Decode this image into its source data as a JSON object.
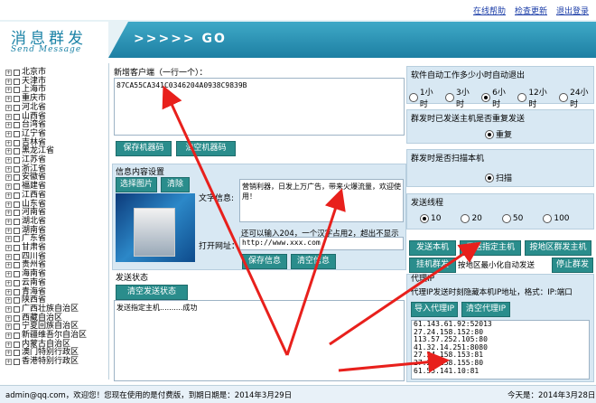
{
  "header": {
    "links": [
      "在线帮助",
      "检查更新",
      "退出登录"
    ],
    "logo_title": "消息群发",
    "logo_subtitle": "Send Message",
    "go_prefix": ">>>>>",
    "go_label": "GO"
  },
  "provinces": [
    "北京市",
    "天津市",
    "上海市",
    "重庆市",
    "河北省",
    "山西省",
    "台湾省",
    "辽宁省",
    "吉林省",
    "黑龙江省",
    "江苏省",
    "浙江省",
    "安徽省",
    "福建省",
    "江西省",
    "山东省",
    "河南省",
    "湖北省",
    "湖南省",
    "广东省",
    "甘肃省",
    "四川省",
    "贵州省",
    "海南省",
    "云南省",
    "青海省",
    "陕西省",
    "广西壮族自治区",
    "西藏自治区",
    "宁夏回族自治区",
    "新疆维吾尔自治区",
    "内蒙古自治区",
    "澳门特别行政区",
    "香港特别行政区"
  ],
  "new_client": {
    "label": "新增客户端（一行一个）：",
    "value": "87CA55CA341C0346204A0938C9839B",
    "save_btn": "保存机器码",
    "clear_btn": "清空机器码"
  },
  "info": {
    "title": "信息内容设置",
    "select_img_btn": "选择图片",
    "remove_btn": "清除",
    "text_label": "文字信息:",
    "text_value": "营销利器，日发上万广告，带来火爆流量，欢迎使用！",
    "hint": "还可以输入204，一个汉字占用2，超出不显示",
    "url_label": "打开网址：",
    "url_value": "http://www.xxx.com",
    "save_btn": "保存信息",
    "clear_btn": "清空信息"
  },
  "send_status": {
    "title": "发送状态",
    "clear_btn": "清空发送状态",
    "log": "发送指定主机..........成功"
  },
  "auto_exit": {
    "title": "软件自动工作多少小时自动退出",
    "options": [
      "1小时",
      "3小时",
      "6小时",
      "12小时",
      "24小时"
    ],
    "selected": 2
  },
  "repeat": {
    "title": "群发时已发送主机是否重复发送",
    "option": "重复"
  },
  "scan": {
    "title": "群发时是否扫描本机",
    "option": "扫描"
  },
  "threads": {
    "title": "发送线程",
    "options": [
      "10",
      "20",
      "50",
      "100"
    ],
    "selected": 0
  },
  "actions": {
    "send_local": "发送本机",
    "send_specified": "发送指定主机",
    "send_region": "按地区群发主机",
    "hang_send": "挂机群发",
    "region_min": "按地区最小化自动发送",
    "stop": "停止群发"
  },
  "proxy": {
    "title": "代理IP",
    "desc": "代理IP发送时刻隐藏本机IP地址，格式：IP:端口",
    "import_btn": "导入代理IP",
    "clear_btn": "清空代理IP",
    "list": [
      "61.143.61.92:52013",
      "27.24.158.152:80",
      "113.57.252.105:80",
      "41.32.14.251:8080",
      "27.24.158.153:81",
      "27.24.158.155:80",
      "61.55.141.10:81"
    ]
  },
  "status": {
    "left": "admin@qq.com，欢迎您！您现在使用的是付费版，到期日期是：2014年3月29日",
    "right": "今天是：2014年3月28日"
  },
  "colors": {
    "accent": "#2a8d8c",
    "panel": "#d8e8f3",
    "annotation": "#e8201c"
  }
}
